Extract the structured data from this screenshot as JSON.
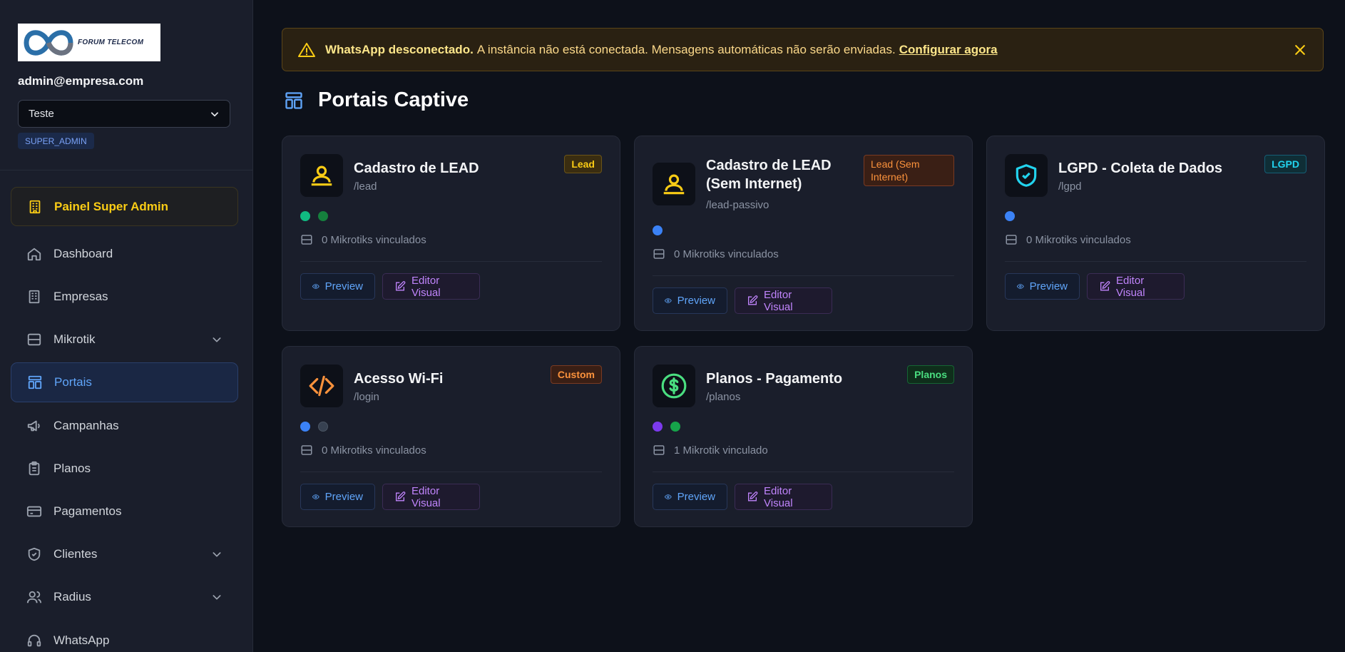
{
  "brand": {
    "logo_text": "FORUM TELECOM"
  },
  "user": {
    "email": "admin@empresa.com",
    "tenant": "Teste",
    "role": "SUPER_ADMIN"
  },
  "sidebar": {
    "super_admin": "Painel Super Admin",
    "items": [
      {
        "label": "Dashboard",
        "icon": "home-icon"
      },
      {
        "label": "Empresas",
        "icon": "building-icon"
      },
      {
        "label": "Mikrotik",
        "icon": "server-icon",
        "expandable": true
      },
      {
        "label": "Portais",
        "icon": "layout-icon",
        "active": true
      },
      {
        "label": "Campanhas",
        "icon": "megaphone-icon"
      },
      {
        "label": "Planos",
        "icon": "clipboard-icon"
      },
      {
        "label": "Pagamentos",
        "icon": "credit-card-icon"
      },
      {
        "label": "Clientes",
        "icon": "shield-icon",
        "expandable": true
      },
      {
        "label": "Radius",
        "icon": "users-icon",
        "expandable": true
      },
      {
        "label": "WhatsApp",
        "icon": "headset-icon"
      }
    ]
  },
  "alert": {
    "title": "WhatsApp desconectado.",
    "message": "A instância não está conectada. Mensagens automáticas não serão enviadas.",
    "link": "Configurar agora"
  },
  "page": {
    "title": "Portais Captive"
  },
  "portals": [
    {
      "title": "Cadastro de LEAD",
      "path": "/lead",
      "badge": "Lead",
      "mikrotiks": "0 Mikrotiks vinculados",
      "preview": "Preview",
      "editor": "Editor Visual"
    },
    {
      "title": "Cadastro de LEAD (Sem Internet)",
      "path": "/lead-passivo",
      "badge": "Lead (Sem Internet)",
      "mikrotiks": "0 Mikrotiks vinculados",
      "preview": "Preview",
      "editor": "Editor Visual"
    },
    {
      "title": "LGPD - Coleta de Dados",
      "path": "/lgpd",
      "badge": "LGPD",
      "mikrotiks": "0 Mikrotiks vinculados",
      "preview": "Preview",
      "editor": "Editor Visual"
    },
    {
      "title": "Acesso Wi-Fi",
      "path": "/login",
      "badge": "Custom",
      "mikrotiks": "0 Mikrotiks vinculados",
      "preview": "Preview",
      "editor": "Editor Visual"
    },
    {
      "title": "Planos - Pagamento",
      "path": "/planos",
      "badge": "Planos",
      "mikrotiks": "1 Mikrotik vinculado",
      "preview": "Preview",
      "editor": "Editor Visual"
    }
  ],
  "colors": {
    "accent": "#60a5fa",
    "warning": "#facc15",
    "purple": "#c084fc"
  }
}
